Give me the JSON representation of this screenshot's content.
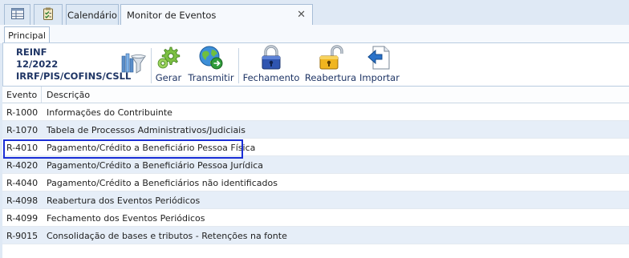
{
  "tabs": {
    "grid_icon": "grid-table-icon",
    "checklist_icon": "clipboard-check-icon",
    "calendar": "Calendário",
    "monitor": "Monitor de Eventos"
  },
  "ribbon": {
    "tab": "Principal",
    "info": {
      "line1": "REINF",
      "line2": "12/2022",
      "line3": "IRRF/PIS/COFINS/CSLL"
    },
    "buttons": {
      "gerar": "Gerar",
      "transmitir": "Transmitir",
      "fechamento": "Fechamento",
      "reabertura": "Reabertura",
      "importar": "Importar"
    }
  },
  "grid": {
    "columns": [
      "Evento",
      "Descrição"
    ],
    "rows": [
      {
        "evento": "R-1000",
        "descricao": "Informações do Contribuinte"
      },
      {
        "evento": "R-1070",
        "descricao": "Tabela de Processos Administrativos/Judiciais"
      },
      {
        "evento": "R-4010",
        "descricao": "Pagamento/Crédito a Beneficiário Pessoa Física"
      },
      {
        "evento": "R-4020",
        "descricao": "Pagamento/Crédito a Beneficiário Pessoa Jurídica"
      },
      {
        "evento": "R-4040",
        "descricao": "Pagamento/Crédito a Beneficiários não identificados"
      },
      {
        "evento": "R-4098",
        "descricao": "Reabertura dos Eventos Periódicos"
      },
      {
        "evento": "R-4099",
        "descricao": "Fechamento dos Eventos Periódicos"
      },
      {
        "evento": "R-9015",
        "descricao": "Consolidação de bases e tributos - Retenções na fonte"
      }
    ]
  },
  "colors": {
    "selection_border": "#1a2ed6",
    "alt_row": "#e6eef8",
    "ribbon_text": "#1f3565"
  }
}
